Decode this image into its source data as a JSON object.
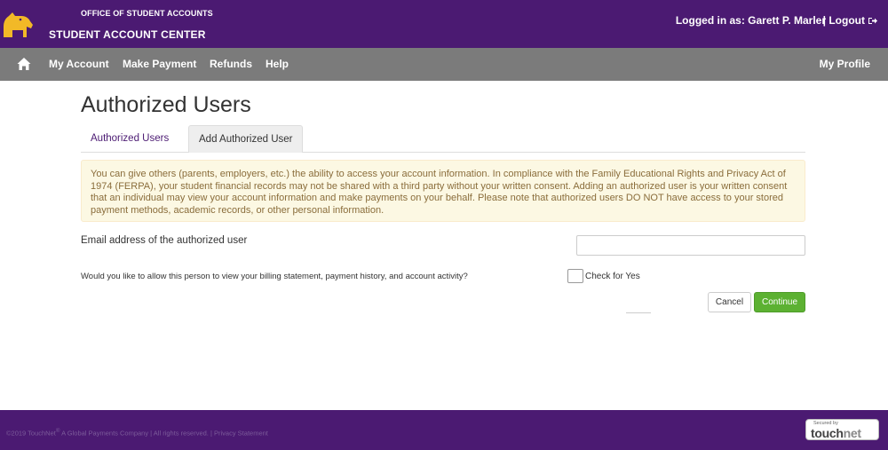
{
  "header": {
    "office_label": "OFFICE OF STUDENT ACCOUNTS",
    "center_title": "STUDENT ACCOUNT CENTER",
    "logged_in_prefix": "Logged in as:",
    "user_name": "Garett P. Marler",
    "logout_label": "| Logout"
  },
  "nav": {
    "items": [
      {
        "label": "My Account"
      },
      {
        "label": "Make Payment"
      },
      {
        "label": "Refunds"
      },
      {
        "label": "Help"
      }
    ],
    "profile_label": "My Profile"
  },
  "page": {
    "title": "Authorized Users",
    "tabs": [
      {
        "label": "Authorized Users",
        "active": true
      },
      {
        "label": "Add Authorized User",
        "active": false
      }
    ],
    "notice": "You can give others (parents, employers, etc.) the ability to access your account information. In compliance with the Family Educational Rights and Privacy Act of 1974 (FERPA), your student financial records may not be shared with a third party without your written consent. Adding an authorized user is your written consent that an individual may view your account information and make payments on your behalf. Please note that authorized users DO NOT have access to your stored payment methods, academic records, or other personal information.",
    "email_label": "Email address of the authorized user",
    "email_value": "",
    "question": "Would you like to allow this person to view your billing statement, payment history, and account activity?",
    "check_label": "Check for Yes",
    "cancel_label": "Cancel",
    "continue_label": "Continue"
  },
  "footer": {
    "copyright_prefix": "©2019 TouchNet",
    "copyright_brand": " A Global Payments Company | All rights reserved. | ",
    "privacy_label": "Privacy Statement",
    "badge_small": "Secured by",
    "badge_touch": "touch",
    "badge_net": "net"
  },
  "colors": {
    "brand_purple": "#4b1a72",
    "nav_gray": "#7b7b7b",
    "accent_green": "#5cb132",
    "notice_bg": "#fcf8e3"
  },
  "icons": {
    "logo": "dog-mascot-icon",
    "home": "home-icon",
    "logout": "logout-arrow-icon"
  }
}
